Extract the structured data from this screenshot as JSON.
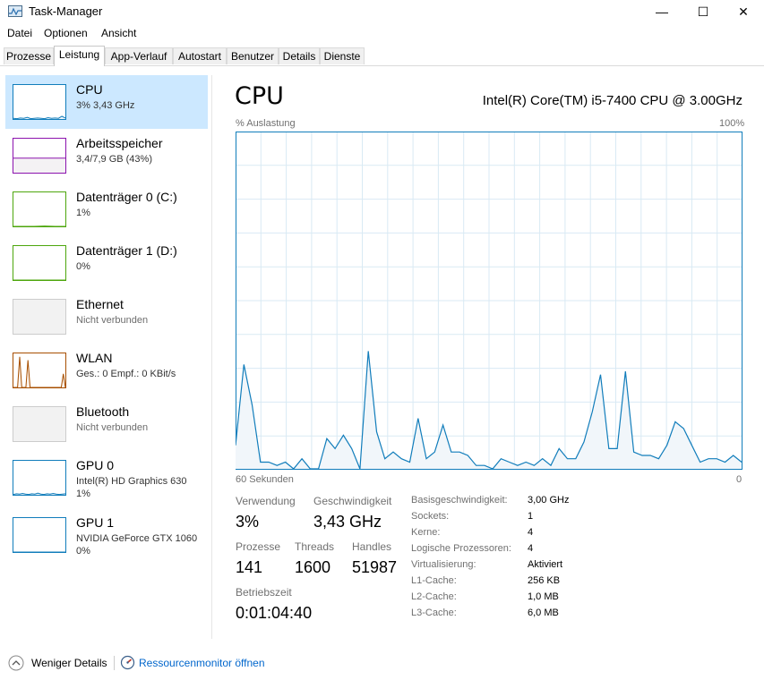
{
  "window": {
    "title": "Task-Manager",
    "controls": {
      "minimize": "—",
      "maximize": "☐",
      "close": "✕"
    }
  },
  "menu": [
    "Datei",
    "Optionen",
    "Ansicht"
  ],
  "tabs": [
    "Prozesse",
    "Leistung",
    "App-Verlauf",
    "Autostart",
    "Benutzer",
    "Details",
    "Dienste"
  ],
  "active_tab": "Leistung",
  "sidebar": [
    {
      "name": "CPU",
      "sub": "3% 3,43 GHz",
      "color": "#117dbb",
      "fill": "#f1f6fa",
      "active": true,
      "usage": [
        2,
        1,
        3,
        2,
        5,
        1,
        2,
        3,
        2,
        1,
        4,
        2,
        3,
        2,
        8,
        3
      ]
    },
    {
      "name": "Arbeitsspeicher",
      "sub": "3,4/7,9 GB (43%)",
      "color": "#8b12ae",
      "fill": "#f4f2f4",
      "usage": [
        43,
        43,
        43,
        43,
        43,
        43
      ]
    },
    {
      "name": "Datenträger 0 (C:)",
      "sub": "1%",
      "color": "#4da60c",
      "fill": "#eff7e8",
      "usage": [
        0,
        0,
        0,
        1,
        0,
        0
      ]
    },
    {
      "name": "Datenträger 1 (D:)",
      "sub": "0%",
      "color": "#4da60c",
      "fill": "#eff7e8",
      "usage": [
        0,
        0,
        0,
        0,
        0,
        0
      ]
    },
    {
      "name": "Ethernet",
      "sub": "Nicht verbunden",
      "color": "#cccccc",
      "fill": "#f2f2f2",
      "disabled": true
    },
    {
      "name": "WLAN",
      "sub": "Ges.: 0 Empf.: 0 KBit/s",
      "color": "#a74f01",
      "fill": "#fcf3eb",
      "usage": [
        0,
        0,
        0,
        90,
        0,
        0,
        0,
        80,
        0,
        0,
        0,
        0,
        0,
        0,
        0,
        0,
        0,
        0,
        0,
        0,
        0,
        0,
        0,
        0,
        40,
        0
      ]
    },
    {
      "name": "Bluetooth",
      "sub": "Nicht verbunden",
      "color": "#cccccc",
      "fill": "#f2f2f2",
      "disabled": true
    },
    {
      "name": "GPU 0",
      "sub": "Intel(R) HD Graphics 630",
      "sub2": "1%",
      "color": "#117dbb",
      "fill": "#f1f6fa",
      "usage": [
        1,
        3,
        2,
        4,
        2,
        1,
        3,
        2,
        5,
        2,
        1,
        3,
        2,
        4,
        2,
        1,
        2,
        3
      ]
    },
    {
      "name": "GPU 1",
      "sub": "NVIDIA GeForce GTX 1060",
      "sub2": "0%",
      "color": "#117dbb",
      "fill": "#f1f6fa",
      "usage": [
        0,
        0,
        0,
        0,
        0,
        0
      ]
    }
  ],
  "main": {
    "title": "CPU",
    "model": "Intel(R) Core(TM) i5-7400 CPU @ 3.00GHz",
    "y_label": "% Auslastung",
    "y_max_label": "100%",
    "x_left_label": "60 Sekunden",
    "x_right_label": "0"
  },
  "chart_data": {
    "type": "area",
    "x_range_seconds": [
      60,
      0
    ],
    "ylim": [
      0,
      100
    ],
    "grid": true,
    "color": "#117dbb",
    "values": [
      7,
      31,
      19,
      2,
      2,
      1,
      2,
      0,
      3,
      0,
      0,
      9,
      6,
      10,
      6,
      0,
      35,
      11,
      3,
      5,
      3,
      2,
      15,
      3,
      5,
      13,
      5,
      5,
      4,
      1,
      1,
      0,
      3,
      2,
      1,
      2,
      1,
      3,
      1,
      6,
      3,
      3,
      8,
      17,
      28,
      6,
      6,
      29,
      5,
      4,
      4,
      3,
      7,
      14,
      12,
      7,
      2,
      3,
      3,
      2,
      4,
      2
    ]
  },
  "stats": {
    "usage_label": "Verwendung",
    "usage_value": "3%",
    "speed_label": "Geschwindigkeit",
    "speed_value": "3,43 GHz",
    "proc_label": "Prozesse",
    "proc_value": "141",
    "threads_label": "Threads",
    "threads_value": "1600",
    "handles_label": "Handles",
    "handles_value": "51987",
    "uptime_label": "Betriebszeit",
    "uptime_value": "0:01:04:40"
  },
  "info": [
    {
      "key": "Basisgeschwindigkeit:",
      "value": "3,00 GHz"
    },
    {
      "key": "Sockets:",
      "value": "1"
    },
    {
      "key": "Kerne:",
      "value": "4"
    },
    {
      "key": "Logische Prozessoren:",
      "value": "4"
    },
    {
      "key": "Virtualisierung:",
      "value": "Aktiviert"
    },
    {
      "key": "L1-Cache:",
      "value": "256 KB"
    },
    {
      "key": "L2-Cache:",
      "value": "1,0 MB"
    },
    {
      "key": "L3-Cache:",
      "value": "6,0 MB"
    }
  ],
  "footer": {
    "fewer_details": "Weniger Details",
    "resource_monitor": "Ressourcenmonitor öffnen",
    "link_color": "#0066cc"
  }
}
